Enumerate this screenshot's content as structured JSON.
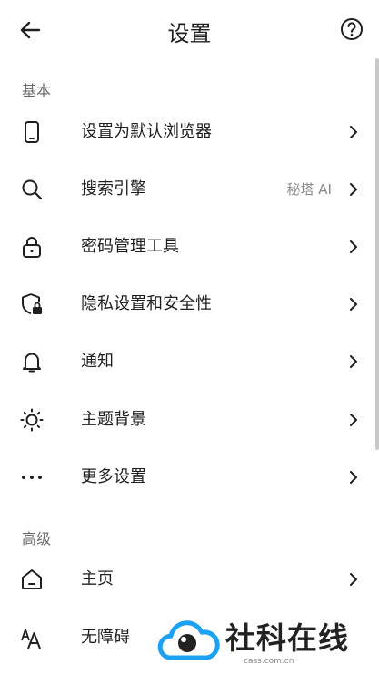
{
  "header": {
    "title": "设置",
    "back_icon": "arrow-left-icon",
    "help_icon": "question-circle-icon"
  },
  "sections": {
    "basic": "基本",
    "advanced": "高级"
  },
  "rows": {
    "default_browser": {
      "label": "设置为默认浏览器",
      "icon": "phone-icon"
    },
    "search_engine": {
      "label": "搜索引擎",
      "value": "秘塔 AI",
      "icon": "search-icon"
    },
    "password_manager": {
      "label": "密码管理工具",
      "icon": "lock-icon"
    },
    "privacy": {
      "label": "隐私设置和安全性",
      "icon": "shield-lock-icon"
    },
    "notifications": {
      "label": "通知",
      "icon": "bell-icon"
    },
    "theme": {
      "label": "主题背景",
      "icon": "sun-icon"
    },
    "more": {
      "label": "更多设置",
      "icon": "more-dots-icon"
    },
    "home": {
      "label": "主页",
      "icon": "home-icon"
    },
    "accessibility": {
      "label": "无障碍",
      "icon": "text-size-icon"
    }
  },
  "watermark": {
    "title": "社科在线",
    "site": "cass.com.cn"
  },
  "colors": {
    "text": "#1f1f1f",
    "secondary": "#6b6b6b",
    "watermark_blue": "#1da1f2"
  }
}
